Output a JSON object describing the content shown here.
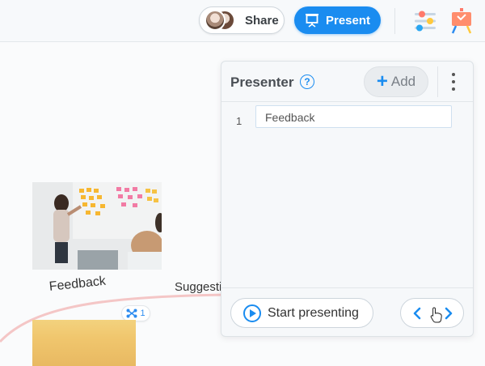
{
  "topbar": {
    "share_label": "Share",
    "present_label": "Present",
    "icons": [
      "avatar",
      "presentation-icon",
      "format-panel-icon",
      "presentation-mode-icon"
    ]
  },
  "canvas": {
    "node_feedback_label": "Feedback",
    "node_suggestion_label": "Suggesti",
    "link_count": "1",
    "colors": {
      "connector": "#f4c6c6",
      "link_badge": "#2d8cf0"
    }
  },
  "presenter": {
    "title": "Presenter",
    "help_glyph": "?",
    "add_label": "Add",
    "slides": [
      {
        "number": "1",
        "title": "Feedback"
      }
    ],
    "start_label": "Start presenting"
  },
  "colors": {
    "accent": "#1a8cf0",
    "panel_bg": "#f6f8fa"
  }
}
